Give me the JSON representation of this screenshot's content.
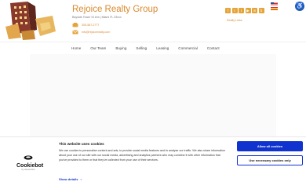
{
  "header": {
    "brand_title": "Rejoice Realty Group",
    "address": "Bayside Tower St #nn | Miami FL 33xxx",
    "phone": "305-587-2777",
    "email": "info@rejoicerealty.com",
    "tagline": "Realty Links"
  },
  "social": {
    "icons": [
      "facebook-icon",
      "twitter-icon",
      "instagram-icon",
      "youtube-icon",
      "linkedin-icon",
      "blog-icon"
    ],
    "glyphs": [
      "f",
      "t",
      "i",
      "▶",
      "in",
      "b"
    ],
    "accent": "#e4a43a"
  },
  "languages": [
    "English",
    "Spanish"
  ],
  "nav": {
    "items": [
      "Home",
      "Our Team",
      "Buying",
      "Selling",
      "Leasing",
      "Commercial",
      "Contact"
    ]
  },
  "cookie": {
    "title": "This website uses cookies",
    "body": "We use cookies to personalise content and ads, to provide social media features and to analyse our traffic. We also share information about your use of our site with our social media, advertising and analytics partners who may combine it with other information that you've provided to them or that they've collected from your use of their services.",
    "show_details": "Show details",
    "allow_all": "Allow all cookies",
    "necessary_only": "Use necessary cookies only",
    "brand": "Cookiebot",
    "brand_sub": "by Usercentrics",
    "button_color": "#1032cf"
  },
  "colors": {
    "brand": "#d88a2f",
    "accessibility": "#1f5fa8"
  }
}
